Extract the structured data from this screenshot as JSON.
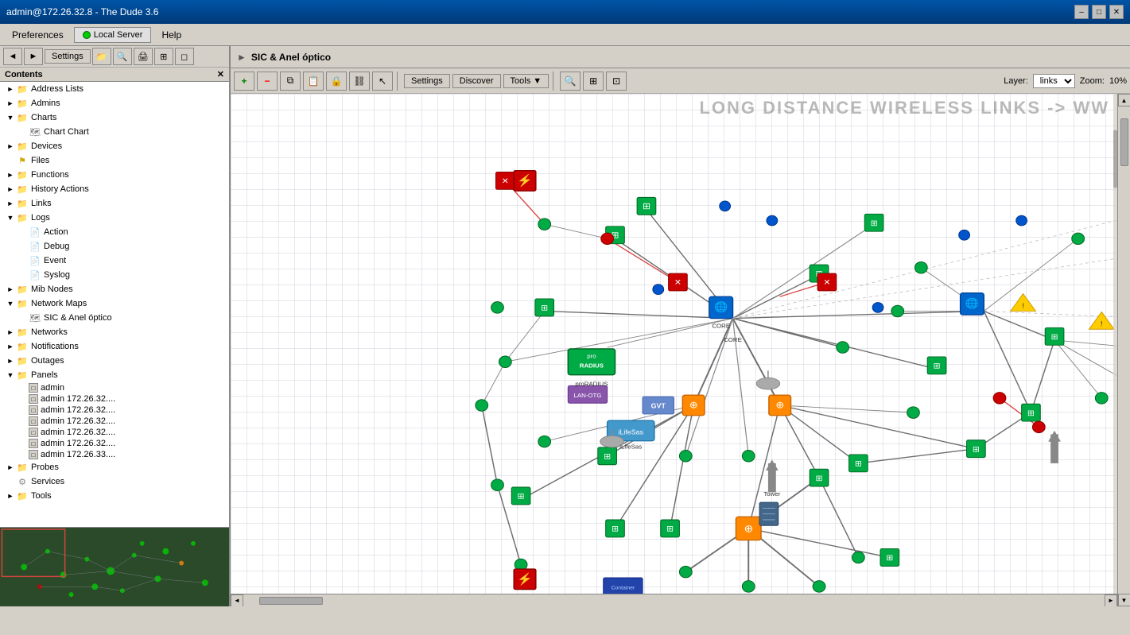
{
  "titlebar": {
    "title": "admin@172.26.32.8 - The Dude 3.6",
    "minimize": "–",
    "maximize": "□",
    "close": "✕"
  },
  "menubar": {
    "preferences_label": "Preferences",
    "server_label": "Local Server",
    "help_label": "Help"
  },
  "toolbar": {
    "settings_label": "Settings",
    "back_label": "◄",
    "forward_label": "►"
  },
  "contents_header": "Contents",
  "tree": {
    "items": [
      {
        "id": "address-lists",
        "label": "Address Lists",
        "level": 0,
        "type": "folder",
        "expanded": false
      },
      {
        "id": "admins",
        "label": "Admins",
        "level": 0,
        "type": "folder",
        "expanded": false
      },
      {
        "id": "charts",
        "label": "Charts",
        "level": 0,
        "type": "folder",
        "expanded": true
      },
      {
        "id": "chart-chart",
        "label": "Chart Chart",
        "level": 1,
        "type": "file",
        "expanded": false
      },
      {
        "id": "devices",
        "label": "Devices",
        "level": 0,
        "type": "folder",
        "expanded": false
      },
      {
        "id": "files",
        "label": "Files",
        "level": 0,
        "type": "file-special",
        "expanded": false
      },
      {
        "id": "functions",
        "label": "Functions",
        "level": 0,
        "type": "folder",
        "expanded": false
      },
      {
        "id": "history-actions",
        "label": "History Actions",
        "level": 0,
        "type": "folder",
        "expanded": false
      },
      {
        "id": "links",
        "label": "Links",
        "level": 0,
        "type": "folder",
        "expanded": false
      },
      {
        "id": "logs",
        "label": "Logs",
        "level": 0,
        "type": "folder",
        "expanded": true
      },
      {
        "id": "action",
        "label": "Action",
        "level": 1,
        "type": "log",
        "expanded": false
      },
      {
        "id": "debug",
        "label": "Debug",
        "level": 1,
        "type": "log",
        "expanded": false
      },
      {
        "id": "event",
        "label": "Event",
        "level": 1,
        "type": "log",
        "expanded": false
      },
      {
        "id": "syslog",
        "label": "Syslog",
        "level": 1,
        "type": "log",
        "expanded": false
      },
      {
        "id": "mib-nodes",
        "label": "Mib Nodes",
        "level": 0,
        "type": "folder",
        "expanded": false
      },
      {
        "id": "network-maps",
        "label": "Network Maps",
        "level": 0,
        "type": "folder",
        "expanded": true
      },
      {
        "id": "sic-anel",
        "label": "SIC & Anel óptico",
        "level": 1,
        "type": "file",
        "expanded": false
      },
      {
        "id": "networks",
        "label": "Networks",
        "level": 0,
        "type": "folder",
        "expanded": false
      },
      {
        "id": "notifications",
        "label": "Notifications",
        "level": 0,
        "type": "folder",
        "expanded": false
      },
      {
        "id": "outages",
        "label": "Outages",
        "level": 0,
        "type": "folder",
        "expanded": false
      },
      {
        "id": "panels",
        "label": "Panels",
        "level": 0,
        "type": "folder",
        "expanded": true
      },
      {
        "id": "panel-admin",
        "label": "admin",
        "level": 1,
        "type": "panel",
        "expanded": false
      },
      {
        "id": "panel-admin-1",
        "label": "admin 172.26.32....",
        "level": 1,
        "type": "panel",
        "expanded": false
      },
      {
        "id": "panel-admin-2",
        "label": "admin 172.26.32....",
        "level": 1,
        "type": "panel",
        "expanded": false
      },
      {
        "id": "panel-admin-3",
        "label": "admin 172.26.32....",
        "level": 1,
        "type": "panel",
        "expanded": false
      },
      {
        "id": "panel-admin-4",
        "label": "admin 172.26.32....",
        "level": 1,
        "type": "panel",
        "expanded": false
      },
      {
        "id": "panel-admin-5",
        "label": "admin 172.26.32....",
        "level": 1,
        "type": "panel",
        "expanded": false
      },
      {
        "id": "panel-admin-6",
        "label": "admin 172.26.33....",
        "level": 1,
        "type": "panel",
        "expanded": false
      },
      {
        "id": "probes",
        "label": "Probes",
        "level": 0,
        "type": "folder",
        "expanded": false
      },
      {
        "id": "services",
        "label": "Services",
        "level": 0,
        "type": "services",
        "expanded": false
      },
      {
        "id": "tools",
        "label": "Tools",
        "level": 0,
        "type": "folder",
        "expanded": false
      }
    ]
  },
  "map_header": {
    "title": "SIC & Anel óptico",
    "arrow": "►"
  },
  "map_toolbar": {
    "add_label": "+",
    "remove_label": "–",
    "copy_label": "⧉",
    "paste_label": "📋",
    "lock_label": "🔒",
    "link_label": "⛓",
    "pointer_label": "↖",
    "settings_label": "Settings",
    "discover_label": "Discover",
    "tools_label": "Tools ▼",
    "search_label": "🔍",
    "grid_label": "⊞",
    "fit_label": "⊡",
    "layer_label": "Layer:",
    "layer_value": "links",
    "zoom_label": "Zoom:",
    "zoom_value": "10%"
  },
  "map_title_overlay": "Long Distance Wireless links -> ww",
  "panels": {
    "items": [
      "admin",
      "admin 172.26.32....",
      "admin 172.26.32....",
      "admin 172.26.32....",
      "admin 172.26.32....",
      "admin 172.26.32....",
      "admin 172.26.33...."
    ]
  },
  "colors": {
    "accent_blue": "#0054a6",
    "tree_bg": "#ffffff",
    "map_bg": "#f8f8ff",
    "node_green": "#00aa00",
    "node_red": "#cc0000",
    "node_orange": "#ff8800",
    "link_dark": "#333333",
    "link_gray": "#888888",
    "grid_line": "#d0d0e0"
  }
}
